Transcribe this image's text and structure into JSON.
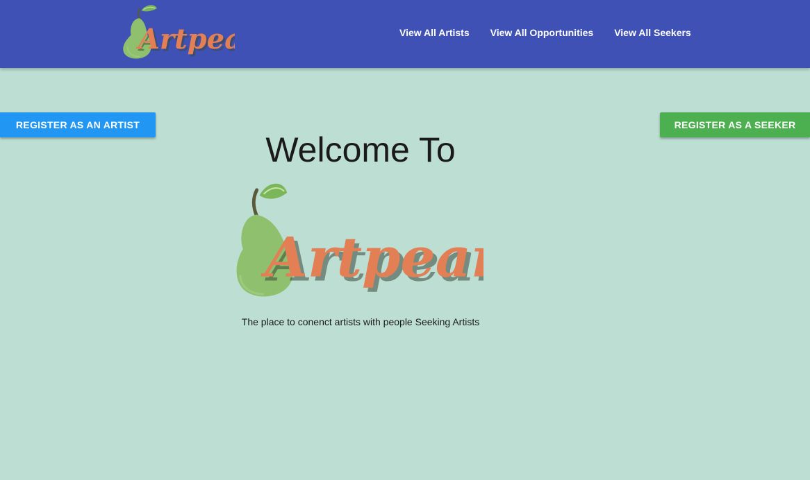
{
  "navbar": {
    "logo_text": "Artpear",
    "background_color": "#3f51b5",
    "links": [
      {
        "label": "View All Artists"
      },
      {
        "label": "View All Opportunities"
      },
      {
        "label": "View All Seekers"
      }
    ]
  },
  "buttons": {
    "register_artist": {
      "label": "REGISTER AS AN ARTIST",
      "color": "#2196f3"
    },
    "register_seeker": {
      "label": "REGISTER AS A SEEKER",
      "color": "#4caf50"
    }
  },
  "hero": {
    "heading": "Welcome To",
    "logo_text": "Artpear",
    "tagline": "The place to conenct artists with people Seeking Artists"
  },
  "theme": {
    "page_background": "#bcded3",
    "logo_pear_color": "#8fc06e",
    "logo_text_color": "#e27f55"
  }
}
